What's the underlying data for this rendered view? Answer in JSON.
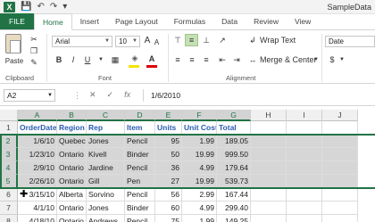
{
  "titlebar": {
    "logo": "X",
    "save_icon": "save-icon",
    "undo_icon": "undo-icon",
    "redo_icon": "redo-icon",
    "title": "SampleData"
  },
  "tabs": [
    "FILE",
    "Home",
    "Insert",
    "Page Layout",
    "Formulas",
    "Data",
    "Review",
    "View"
  ],
  "ribbon": {
    "paste_label": "Paste",
    "clipboard_label": "Clipboard",
    "font_name": "Arial",
    "font_size": "10",
    "font_label": "Font",
    "bold": "B",
    "italic": "I",
    "underline": "U",
    "wrap_text": "Wrap Text",
    "merge_center": "Merge & Center",
    "alignment_label": "Alignment",
    "number_format": "Date",
    "currency_symbol": "$",
    "grow_font": "A",
    "shrink_font": "A",
    "font_color": "A"
  },
  "formula_bar": {
    "name_box": "A2",
    "cancel": "✕",
    "enter": "✓",
    "fx": "fx",
    "value": "1/6/2010"
  },
  "grid": {
    "columns": [
      "A",
      "B",
      "C",
      "D",
      "E",
      "F",
      "G",
      "H",
      "I",
      "J"
    ],
    "row_numbers": [
      "1",
      "2",
      "3",
      "4",
      "5",
      "6",
      "7",
      "8"
    ],
    "header": [
      "OrderDate",
      "Region",
      "Rep",
      "Item",
      "Units",
      "Unit Cost",
      "Total"
    ],
    "rows": [
      [
        "1/6/10",
        "Quebec",
        "Jones",
        "Pencil",
        "95",
        "1.99",
        "189.05"
      ],
      [
        "1/23/10",
        "Ontario",
        "Kivell",
        "Binder",
        "50",
        "19.99",
        "999.50"
      ],
      [
        "2/9/10",
        "Ontario",
        "Jardine",
        "Pencil",
        "36",
        "4.99",
        "179.64"
      ],
      [
        "2/26/10",
        "Ontario",
        "Gill",
        "Pen",
        "27",
        "19.99",
        "539.73"
      ],
      [
        "3/15/10",
        "Alberta",
        "Sorvino",
        "Pencil",
        "56",
        "2.99",
        "167.44"
      ],
      [
        "4/1/10",
        "Ontario",
        "Jones",
        "Binder",
        "60",
        "4.99",
        "299.40"
      ],
      [
        "4/18/10",
        "Ontario",
        "Andrews",
        "Pencil",
        "75",
        "1.99",
        "149.25"
      ]
    ]
  },
  "colors": {
    "accent": "#217346",
    "header_text": "#2a5db0",
    "selection": "#d6d6d6"
  }
}
